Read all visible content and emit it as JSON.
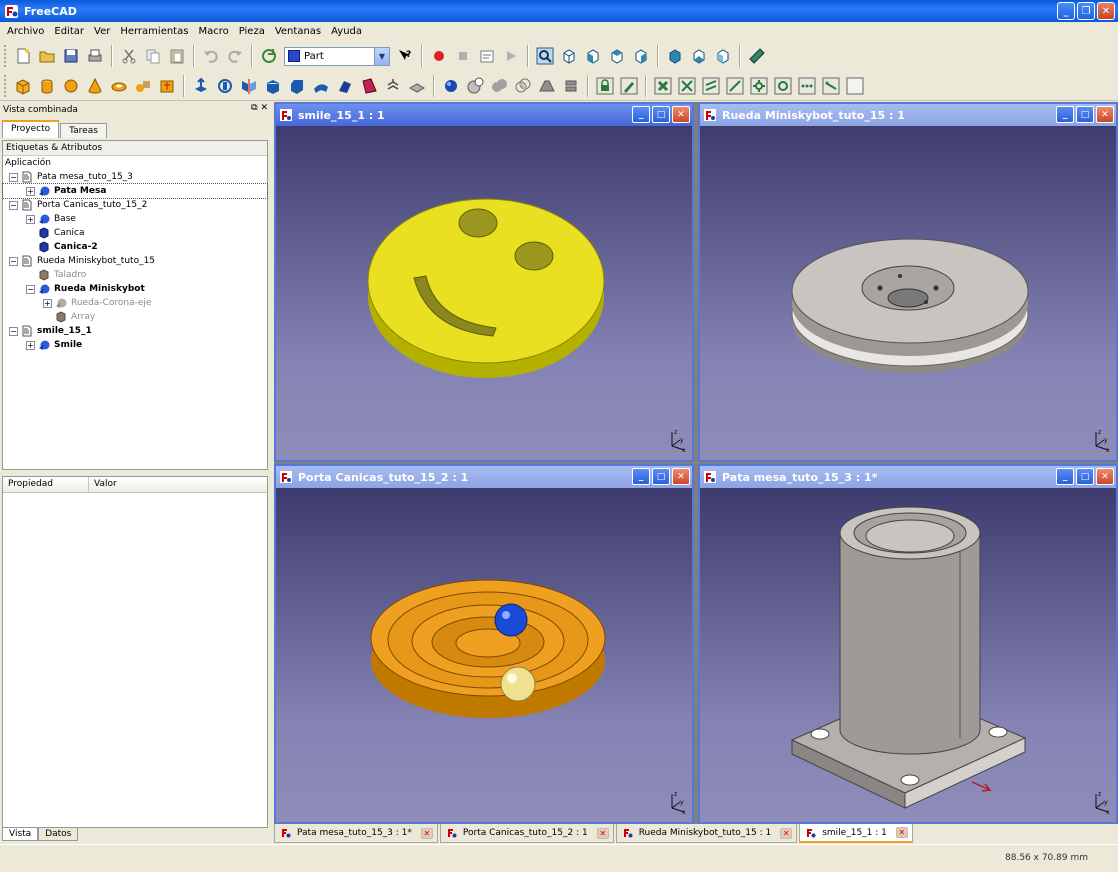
{
  "app": {
    "title": "FreeCAD"
  },
  "menu": [
    "Archivo",
    "Editar",
    "Ver",
    "Herramientas",
    "Macro",
    "Pieza",
    "Ventanas",
    "Ayuda"
  ],
  "toolbar": {
    "workbench": "Part"
  },
  "panel": {
    "title": "Vista combinada",
    "tabs": [
      "Proyecto",
      "Tareas"
    ],
    "tree_header": "Etiquetas & Atributos",
    "tree_root": "Aplicación",
    "tree": [
      {
        "label": "Pata mesa_tuto_15_3",
        "level": 0,
        "expander": "−",
        "icon": "document-icon"
      },
      {
        "label": "Pata Mesa",
        "level": 1,
        "expander": "+",
        "icon": "part-blue-icon",
        "style": "bold"
      },
      {
        "label": "Porta Canicas_tuto_15_2",
        "level": 0,
        "expander": "−",
        "icon": "document-icon"
      },
      {
        "label": "Base",
        "level": 1,
        "expander": "+",
        "icon": "part-blue-icon",
        "style": "normal"
      },
      {
        "label": "Canica",
        "level": 1,
        "expander": "",
        "icon": "solid-cube-icon",
        "style": "normal"
      },
      {
        "label": "Canica-2",
        "level": 1,
        "expander": "",
        "icon": "solid-cube-icon",
        "style": "bold"
      },
      {
        "label": "Rueda Miniskybot_tuto_15",
        "level": 0,
        "expander": "−",
        "icon": "document-icon"
      },
      {
        "label": "Taladro",
        "level": 1,
        "expander": "",
        "icon": "hidden-cube-icon",
        "style": "grey"
      },
      {
        "label": "Rueda Miniskybot",
        "level": 1,
        "expander": "−",
        "icon": "part-blue-icon",
        "style": "bold"
      },
      {
        "label": "Rueda-Corona-eje",
        "level": 2,
        "expander": "+",
        "icon": "part-grey-icon",
        "style": "grey"
      },
      {
        "label": "Array",
        "level": 2,
        "expander": "",
        "icon": "hidden-cube-icon",
        "style": "grey"
      },
      {
        "label": "smile_15_1",
        "level": 0,
        "expander": "−",
        "icon": "document-icon",
        "style": "bold"
      },
      {
        "label": "Smile",
        "level": 1,
        "expander": "+",
        "icon": "part-blue-icon",
        "style": "bold"
      }
    ],
    "property_columns": [
      "Propiedad",
      "Valor"
    ],
    "bottom_tabs": [
      "Vista",
      "Datos"
    ]
  },
  "views": [
    {
      "title": "smile_15_1 : 1",
      "active": true
    },
    {
      "title": "Rueda Miniskybot_tuto_15 : 1",
      "active": false
    },
    {
      "title": "Porta Canicas_tuto_15_2 : 1",
      "active": false
    },
    {
      "title": "Pata mesa_tuto_15_3 : 1*",
      "active": false
    }
  ],
  "doc_tabs": [
    "Pata mesa_tuto_15_3 : 1*",
    "Porta Canicas_tuto_15_2 : 1",
    "Rueda Miniskybot_tuto_15 : 1",
    "smile_15_1 : 1"
  ],
  "doc_tabs_active": 3,
  "status": {
    "dimensions": "88.56 x 70.89 mm"
  },
  "colors": {
    "titlebar": "#0a5ae0",
    "viewport_top": "#3e3b6e",
    "viewport_bottom": "#8e8cb8",
    "smile": "#e8e020",
    "porta": "#f0a020"
  }
}
